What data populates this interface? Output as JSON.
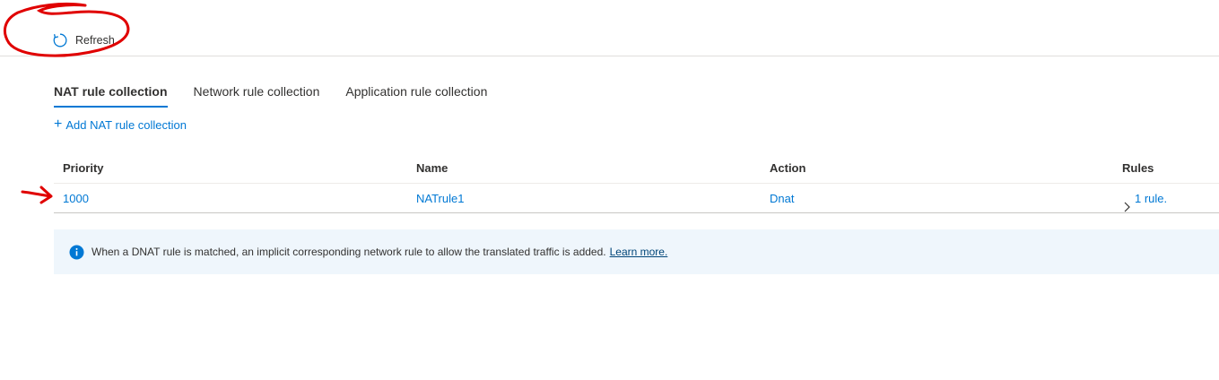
{
  "toolbar": {
    "refresh_label": "Refresh",
    "refresh_icon": "refresh-icon"
  },
  "tabs": [
    {
      "label": "NAT rule collection",
      "active": true
    },
    {
      "label": "Network rule collection",
      "active": false
    },
    {
      "label": "Application rule collection",
      "active": false
    }
  ],
  "add_button": {
    "label": "Add NAT rule collection",
    "icon": "plus-icon"
  },
  "table": {
    "columns": [
      "Priority",
      "Name",
      "Action",
      "Rules"
    ],
    "rows": [
      {
        "priority": "1000",
        "name": "NATrule1",
        "action": "Dnat",
        "rules": "1 rule."
      }
    ]
  },
  "info": {
    "icon": "info-icon",
    "message": "When a DNAT rule is matched, an implicit corresponding network rule to allow the translated traffic is added.",
    "link": "Learn more."
  },
  "annotations": {
    "color": "#e00000",
    "items": [
      "circle around refresh button",
      "arrow pointing at first row"
    ]
  },
  "colors": {
    "accent": "#0078d4",
    "info_background": "#eff6fc"
  }
}
